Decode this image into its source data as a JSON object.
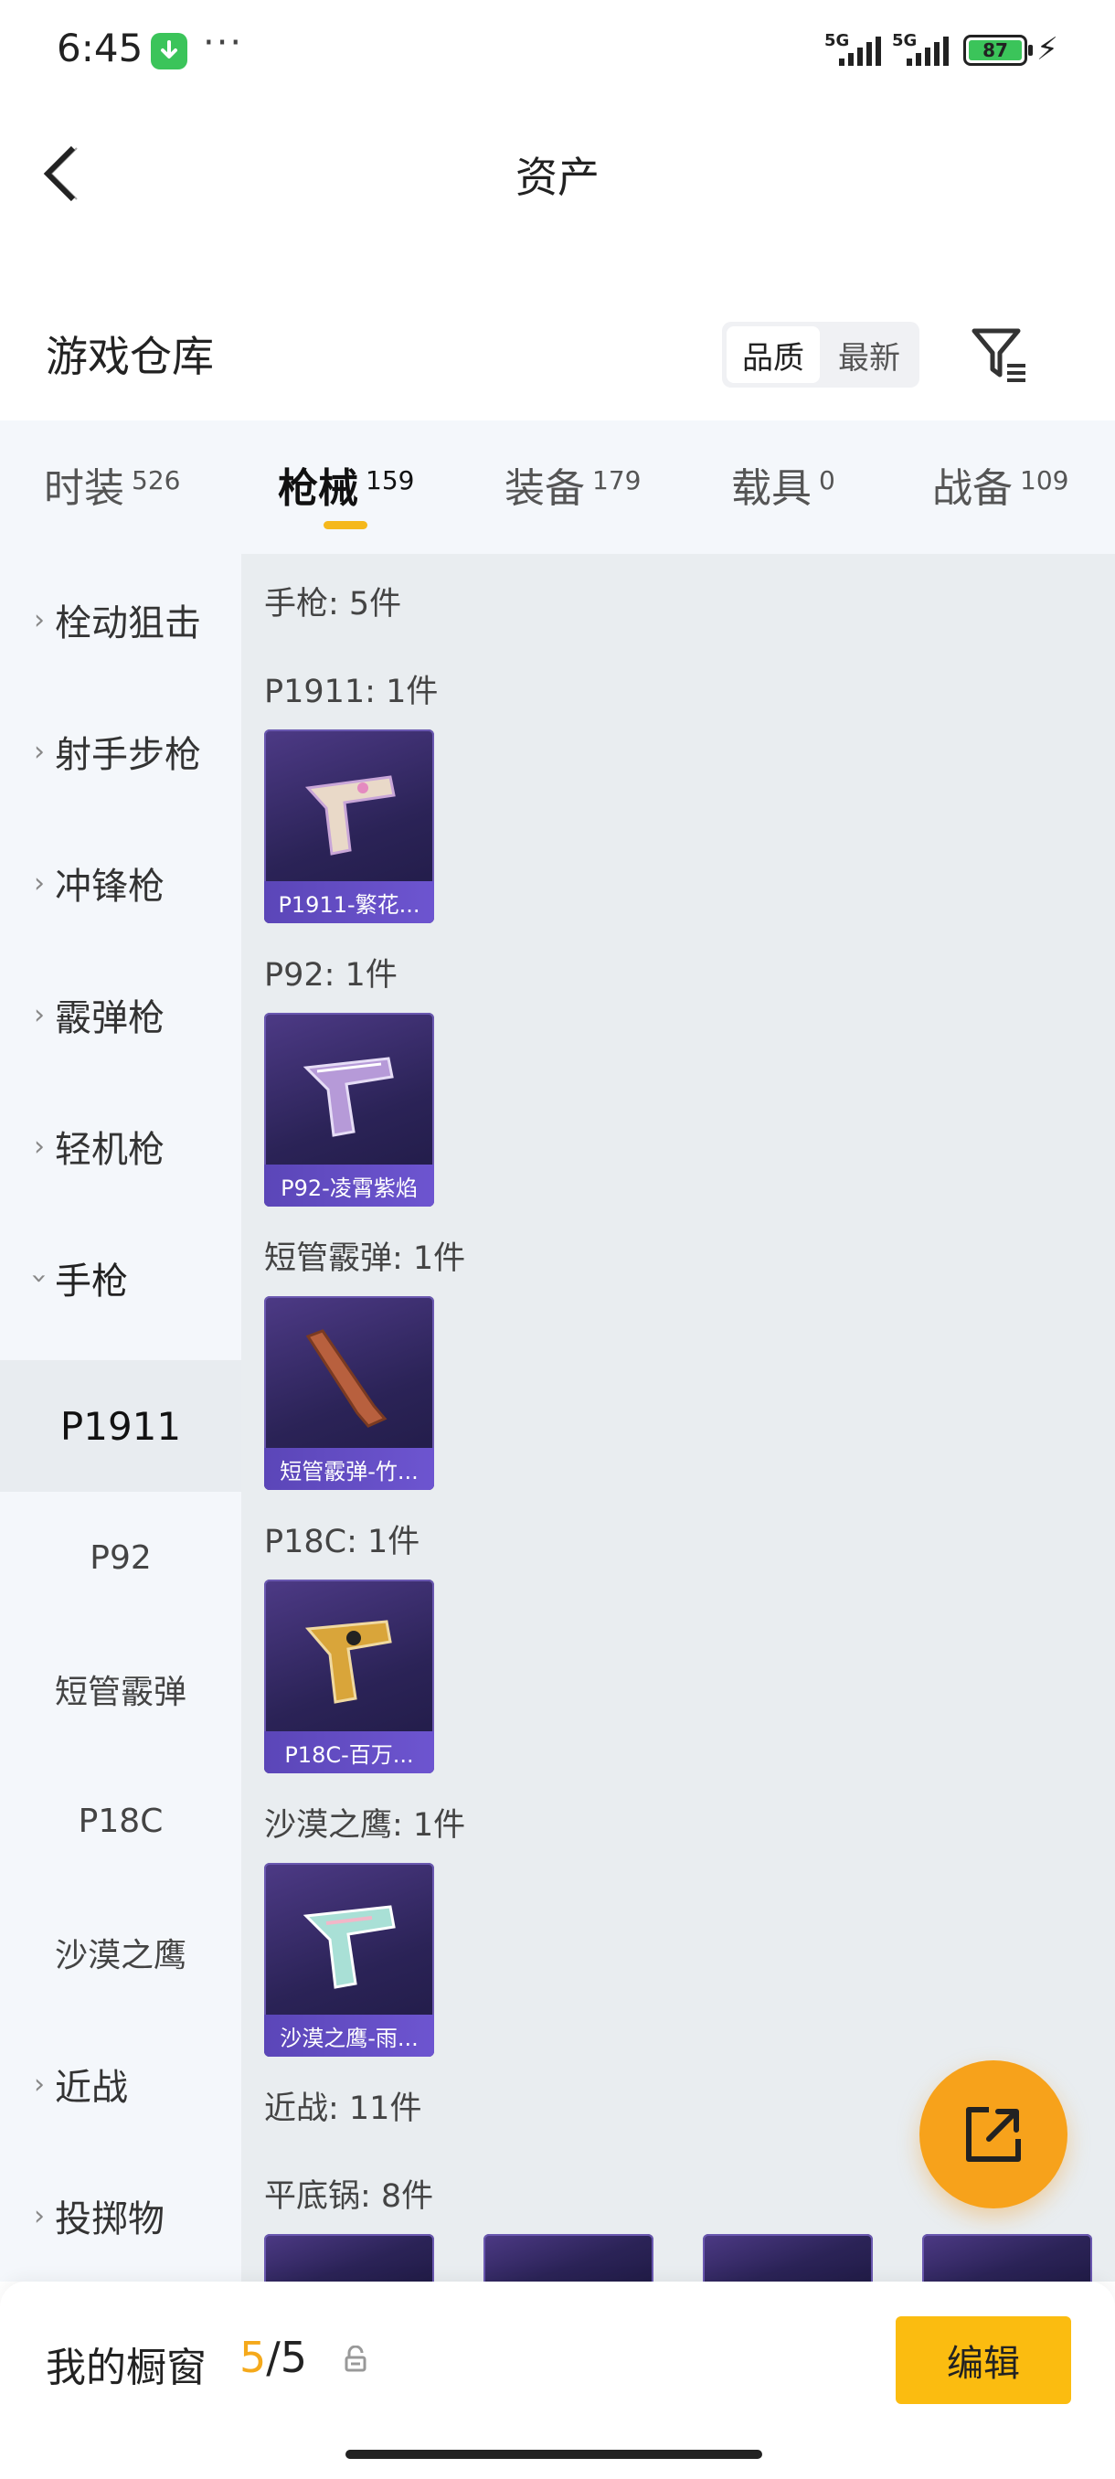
{
  "status": {
    "time": "6:45",
    "signal1": "5G",
    "signal2": "5G",
    "battery": "87"
  },
  "header": {
    "title": "资产"
  },
  "warehouse": {
    "title": "游戏仓库",
    "sort_quality": "品质",
    "sort_newest": "最新"
  },
  "tabs": [
    {
      "label": "时装",
      "count": "526"
    },
    {
      "label": "枪械",
      "count": "159"
    },
    {
      "label": "装备",
      "count": "179"
    },
    {
      "label": "载具",
      "count": "0"
    },
    {
      "label": "战备",
      "count": "109"
    }
  ],
  "nav": {
    "categories": [
      "栓动狙击",
      "射手步枪",
      "冲锋枪",
      "霰弹枪",
      "轻机枪",
      "手枪"
    ],
    "sub": [
      "P1911",
      "P92",
      "短管霰弹",
      "P18C",
      "沙漠之鹰"
    ],
    "more": [
      "近战",
      "投掷物"
    ]
  },
  "content": {
    "pistol_header": "手枪: 5件",
    "groups": [
      {
        "header": "P1911: 1件",
        "item": "P1911-繁花..."
      },
      {
        "header": "P92: 1件",
        "item": "P92-凌霄紫焰"
      },
      {
        "header": "短管霰弹: 1件",
        "item": "短管霰弹-竹..."
      },
      {
        "header": "P18C: 1件",
        "item": "P18C-百万..."
      },
      {
        "header": "沙漠之鹰: 1件",
        "item": "沙漠之鹰-雨..."
      }
    ],
    "melee_header": "近战: 11件",
    "pan_header": "平底锅: 8件"
  },
  "bottom": {
    "label": "我的橱窗",
    "count_current": "5",
    "count_total": "/5",
    "edit": "编辑"
  },
  "colors": {
    "accent": "#f5b81c",
    "fab": "#f7a21b",
    "card": "#2b2357"
  }
}
